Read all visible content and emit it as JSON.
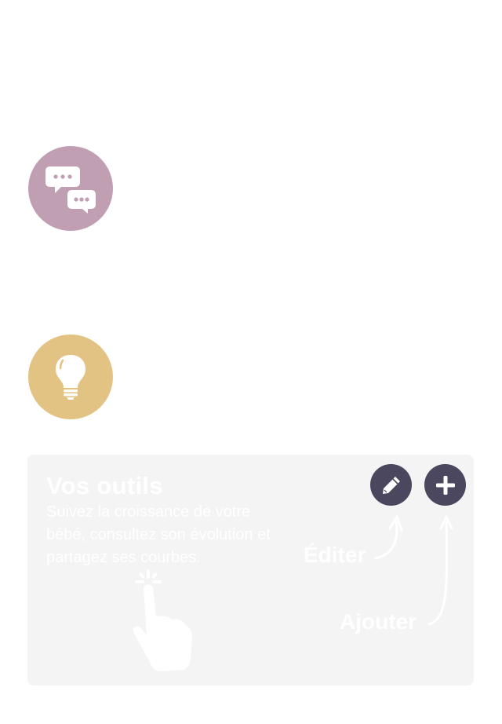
{
  "features": {
    "chat": {
      "icon": "chat-bubbles-icon",
      "color": "#c19fb3"
    },
    "tips": {
      "icon": "lightbulb-icon",
      "color": "#e2c383"
    }
  },
  "tools": {
    "title": "Vos outils",
    "description": "Suivez la croissance de votre bébé, consultez son évolution et partagez ses courbes.",
    "edit_label": "Éditer",
    "add_label": "Ajouter",
    "edit_icon": "pencil-icon",
    "add_icon": "plus-icon",
    "gesture_icon": "tap-hand-icon",
    "button_color": "#4a475f"
  }
}
